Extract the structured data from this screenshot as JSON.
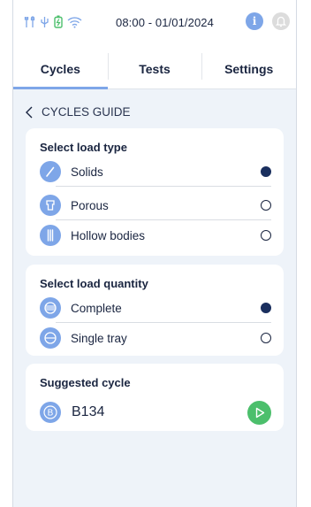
{
  "status": {
    "datetime": "08:00 - 01/01/2024",
    "info_label": "i",
    "icons": [
      "tools-icon",
      "usb-icon",
      "battery-icon",
      "wifi-icon"
    ]
  },
  "tabs": [
    {
      "label": "Cycles",
      "active": true
    },
    {
      "label": "Tests",
      "active": false
    },
    {
      "label": "Settings",
      "active": false
    }
  ],
  "breadcrumb": "CYCLES GUIDE",
  "load_type": {
    "title": "Select load type",
    "options": [
      {
        "label": "Solids",
        "icon": "solids-icon",
        "selected": true
      },
      {
        "label": "Porous",
        "icon": "porous-icon",
        "selected": false
      },
      {
        "label": "Hollow bodies",
        "icon": "hollow-bodies-icon",
        "selected": false
      }
    ]
  },
  "load_quantity": {
    "title": "Select load quantity",
    "options": [
      {
        "label": "Complete",
        "icon": "complete-icon",
        "selected": true
      },
      {
        "label": "Single tray",
        "icon": "single-tray-icon",
        "selected": false
      }
    ]
  },
  "suggested": {
    "title": "Suggested cycle",
    "cycle": "B134",
    "badge": "B"
  },
  "colors": {
    "accent": "#7ea6e8",
    "selected": "#1a2f5e",
    "play": "#4cbf6c",
    "background": "#eef3f9"
  }
}
